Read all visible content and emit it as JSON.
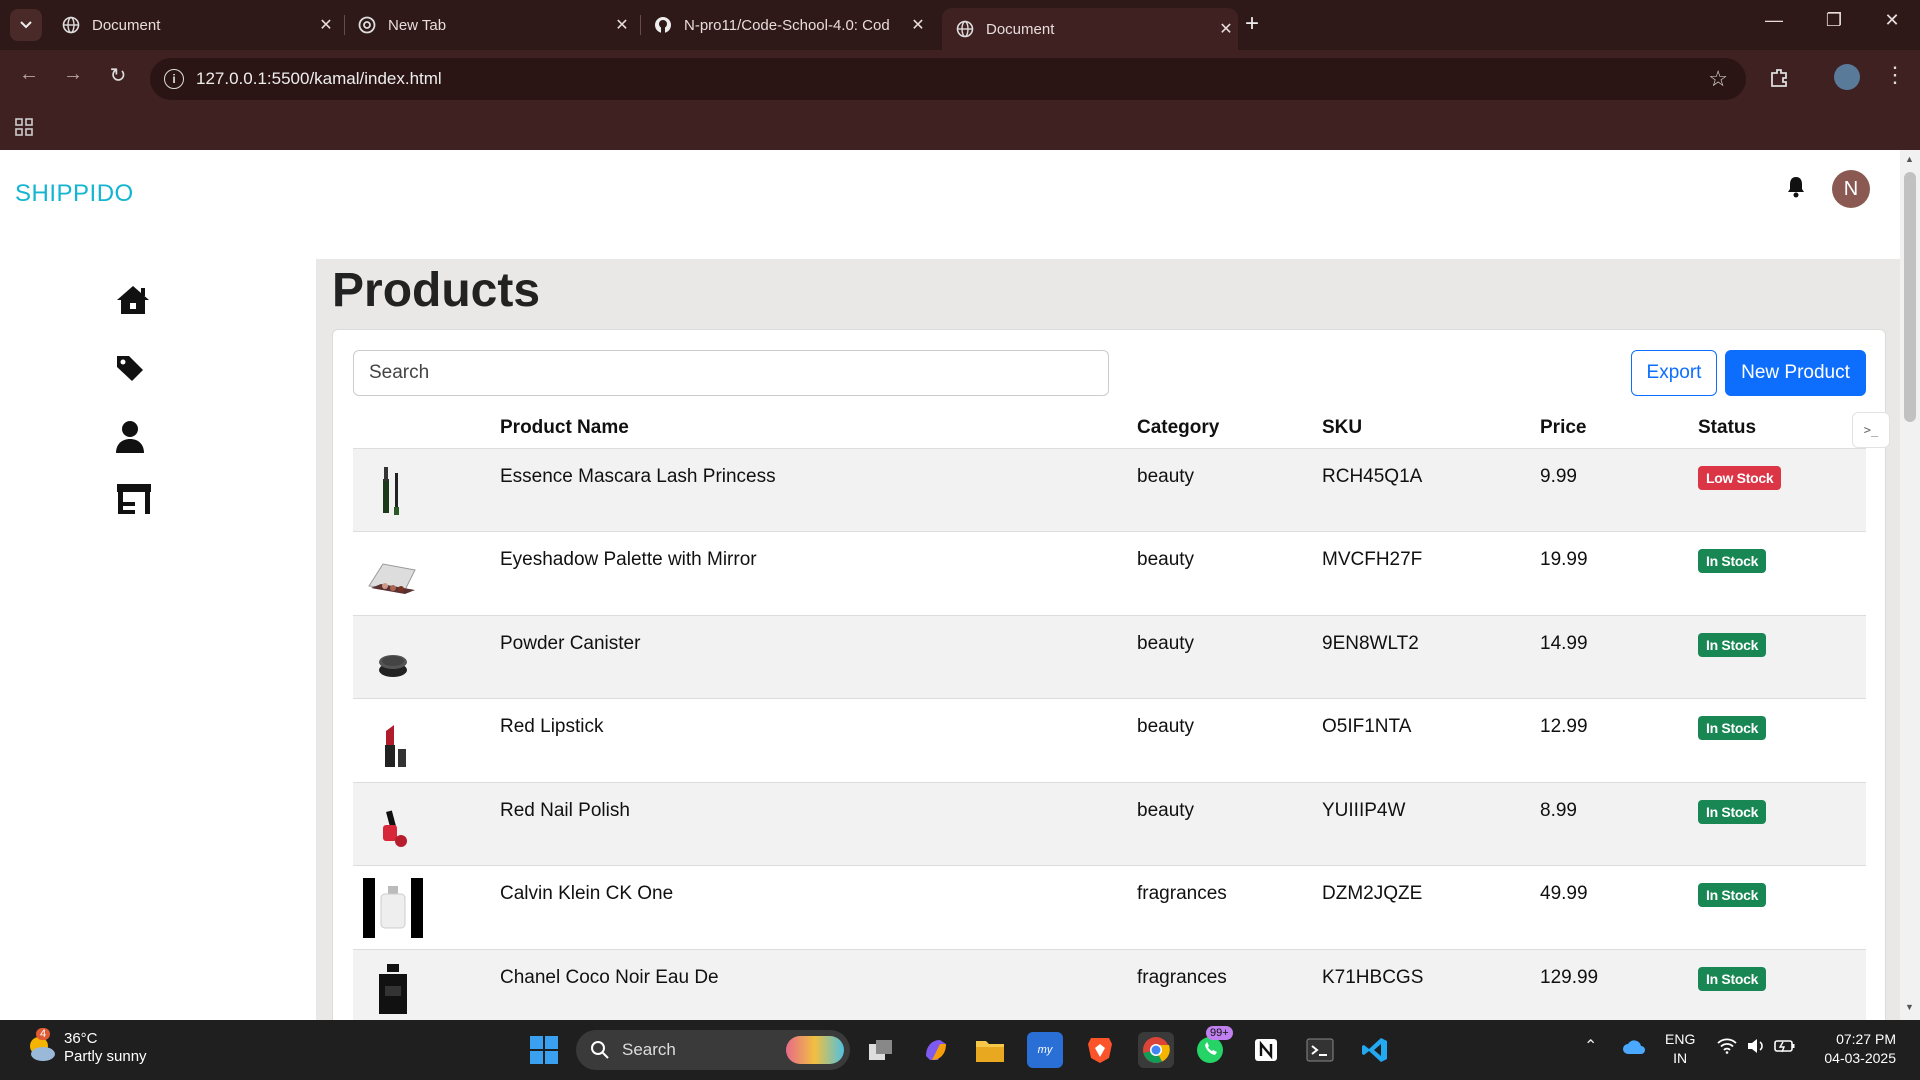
{
  "browser": {
    "tabs": [
      {
        "title": "Document"
      },
      {
        "title": "New Tab"
      },
      {
        "title": "N-pro11/Code-School-4.0: Cod"
      },
      {
        "title": "Document"
      }
    ],
    "url": "127.0.0.1:5500/kamal/index.html"
  },
  "app": {
    "brand": "SHIPPIDO",
    "avatar_initial": "N",
    "page_title": "Products",
    "search_placeholder": "Search",
    "export_label": "Export",
    "new_product_label": "New Product"
  },
  "table": {
    "headers": [
      "",
      "Product Name",
      "Category",
      "SKU",
      "Price",
      "Status"
    ],
    "rows": [
      {
        "name": "Essence Mascara Lash Princess",
        "category": "beauty",
        "sku": "RCH45Q1A",
        "price": "9.99",
        "status": "Low Stock",
        "image": "mascara"
      },
      {
        "name": "Eyeshadow Palette with Mirror",
        "category": "beauty",
        "sku": "MVCFH27F",
        "price": "19.99",
        "status": "In Stock",
        "image": "palette"
      },
      {
        "name": "Powder Canister",
        "category": "beauty",
        "sku": "9EN8WLT2",
        "price": "14.99",
        "status": "In Stock",
        "image": "powder"
      },
      {
        "name": "Red Lipstick",
        "category": "beauty",
        "sku": "O5IF1NTA",
        "price": "12.99",
        "status": "In Stock",
        "image": "lipstick"
      },
      {
        "name": "Red Nail Polish",
        "category": "beauty",
        "sku": "YUIIIP4W",
        "price": "8.99",
        "status": "In Stock",
        "image": "nailpolish"
      },
      {
        "name": "Calvin Klein CK One",
        "category": "fragrances",
        "sku": "DZM2JQZE",
        "price": "49.99",
        "status": "In Stock",
        "image": "ckone"
      },
      {
        "name": "Chanel Coco Noir Eau De",
        "category": "fragrances",
        "sku": "K71HBCGS",
        "price": "129.99",
        "status": "In Stock",
        "image": "chanel"
      }
    ]
  },
  "taskbar": {
    "weather_badge": "4",
    "temperature": "36°C",
    "weather": "Partly sunny",
    "search": "Search",
    "whatsapp_badge": "99+",
    "lang": "ENG",
    "region": "IN",
    "time": "07:27 PM",
    "date": "04-03-2025"
  },
  "colors": {
    "brand": "#13b5d1",
    "primary": "#0d6efd",
    "low_stock": "#dc3545",
    "in_stock": "#198754"
  }
}
